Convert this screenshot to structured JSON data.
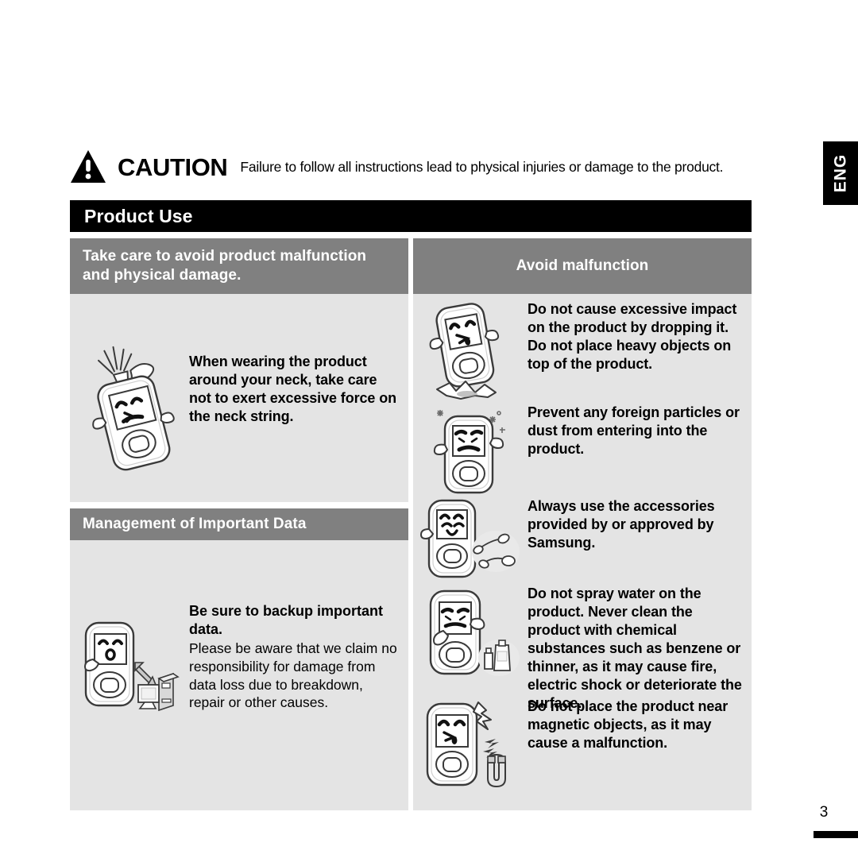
{
  "caution": {
    "icon": "warning-triangle-icon",
    "word": "CAUTION",
    "description": "Failure to follow all instructions lead to physical injuries or damage to the product."
  },
  "language_tab": {
    "label": "ENG"
  },
  "section": {
    "title": "Product Use"
  },
  "left_column": {
    "panel_one": {
      "header": "Take care to avoid product malfunction and physical damage.",
      "illustration": "player-broken-neck-strap-icon",
      "text": "When wearing the product around your neck, take care not to exert excessive force on the neck string."
    },
    "panel_two": {
      "header": "Management of Important Data",
      "illustration": "player-backup-to-pc-icon",
      "heading": "Be sure to backup important data.",
      "body": "Please be aware that we claim no responsibility for damage from data loss due to breakdown, repair or other causes."
    }
  },
  "right_column": {
    "header": "Avoid malfunction",
    "items": [
      {
        "illustration": "player-dropped-impact-icon",
        "text": "Do not cause excessive impact on the product by dropping it. Do not place heavy objects on top of the product."
      },
      {
        "illustration": "player-dust-particles-icon",
        "text": "Prevent any foreign particles or dust from entering into the product."
      },
      {
        "illustration": "player-approved-accessories-icon",
        "text": "Always use the accessories provided by or approved by Samsung."
      },
      {
        "illustration": "player-no-water-chemicals-icon",
        "text": "Do not spray water on the product. Never clean the product with chemical substances such as benzene or thinner, as it may cause fire, electric shock or deteriorate the surface."
      },
      {
        "illustration": "player-magnet-icon",
        "text": "Do not place the product near magnetic objects, as it may cause a malfunction."
      }
    ]
  },
  "footer": {
    "page_number": "3"
  },
  "colors": {
    "header_bar": "#000000",
    "panel_header": "#808080",
    "panel_body": "#e4e4e4",
    "page_background": "#ffffff",
    "text": "#000000"
  }
}
